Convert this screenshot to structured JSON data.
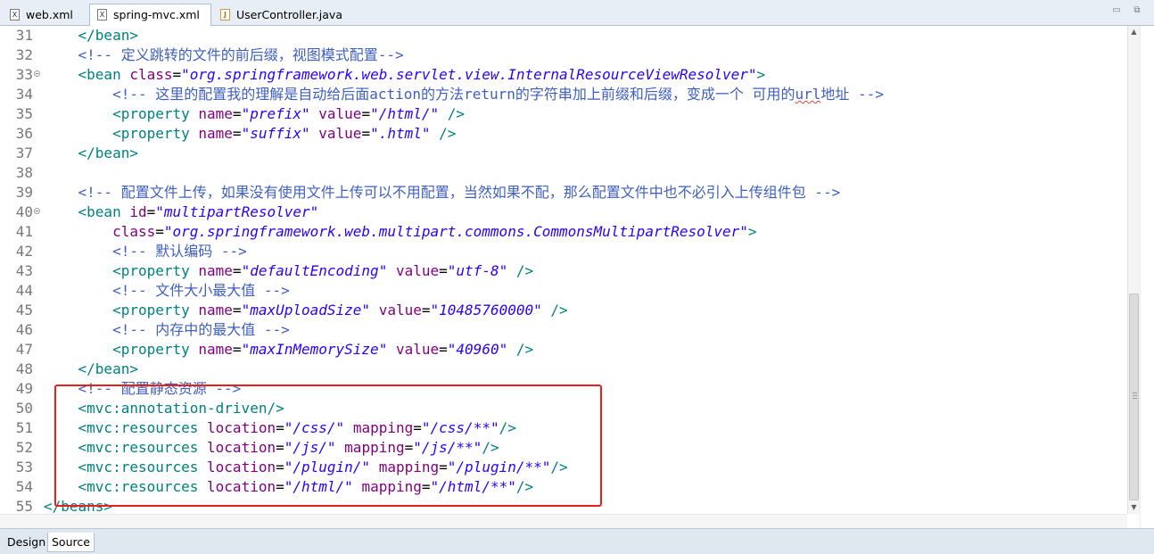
{
  "tabs": [
    {
      "label": "web.xml",
      "icon": "xml-file-icon",
      "active": false
    },
    {
      "label": "spring-mvc.xml",
      "icon": "xml-file-icon",
      "active": true
    },
    {
      "label": "UserController.java",
      "icon": "java-file-icon",
      "active": false
    }
  ],
  "editor_lines": [
    {
      "num": "31",
      "fold": false,
      "tokens": [
        [
          "    ",
          "p"
        ],
        [
          "</bean>",
          "t"
        ]
      ]
    },
    {
      "num": "32",
      "fold": false,
      "tokens": [
        [
          "    ",
          "p"
        ],
        [
          "<!-- ",
          "cm"
        ],
        [
          "定义跳转的文件的前后缀，视图模式配置",
          "cmc"
        ],
        [
          "-->",
          "cm"
        ]
      ]
    },
    {
      "num": "33",
      "fold": true,
      "tokens": [
        [
          "    ",
          "p"
        ],
        [
          "<bean ",
          "t"
        ],
        [
          "class",
          "an"
        ],
        [
          "=",
          "p"
        ],
        [
          "\"org.springframework.web.servlet.view.InternalResourceViewResolver\"",
          "av"
        ],
        [
          ">",
          "t"
        ]
      ]
    },
    {
      "num": "34",
      "fold": false,
      "tokens": [
        [
          "        ",
          "p"
        ],
        [
          "<!-- ",
          "cm"
        ],
        [
          "这里的配置我的理解是自动给后面",
          "cmc"
        ],
        [
          "action",
          "cm"
        ],
        [
          "的方法",
          "cmc"
        ],
        [
          "return",
          "cm"
        ],
        [
          "的字符串加上前缀和后缀，变成一个 可用的",
          "cmc"
        ],
        [
          "url",
          "cmsq"
        ],
        [
          "地址 ",
          "cmc"
        ],
        [
          "-->",
          "cm"
        ]
      ]
    },
    {
      "num": "35",
      "fold": false,
      "tokens": [
        [
          "        ",
          "p"
        ],
        [
          "<property ",
          "t"
        ],
        [
          "name",
          "an"
        ],
        [
          "=",
          "p"
        ],
        [
          "\"prefix\"",
          "av"
        ],
        [
          " ",
          "p"
        ],
        [
          "value",
          "an"
        ],
        [
          "=",
          "p"
        ],
        [
          "\"/html/\"",
          "av"
        ],
        [
          " />",
          "t"
        ]
      ]
    },
    {
      "num": "36",
      "fold": false,
      "tokens": [
        [
          "        ",
          "p"
        ],
        [
          "<property ",
          "t"
        ],
        [
          "name",
          "an"
        ],
        [
          "=",
          "p"
        ],
        [
          "\"suffix\"",
          "av"
        ],
        [
          " ",
          "p"
        ],
        [
          "value",
          "an"
        ],
        [
          "=",
          "p"
        ],
        [
          "\".html\"",
          "av"
        ],
        [
          " />",
          "t"
        ]
      ]
    },
    {
      "num": "37",
      "fold": false,
      "tokens": [
        [
          "    ",
          "p"
        ],
        [
          "</bean>",
          "t"
        ]
      ]
    },
    {
      "num": "38",
      "fold": false,
      "tokens": []
    },
    {
      "num": "39",
      "fold": false,
      "tokens": [
        [
          "    ",
          "p"
        ],
        [
          "<!-- ",
          "cm"
        ],
        [
          "配置文件上传，如果没有使用文件上传可以不用配置，当然如果不配，那么配置文件中也不必引入上传组件包 ",
          "cmc"
        ],
        [
          "-->",
          "cm"
        ]
      ]
    },
    {
      "num": "40",
      "fold": true,
      "tokens": [
        [
          "    ",
          "p"
        ],
        [
          "<bean ",
          "t"
        ],
        [
          "id",
          "an"
        ],
        [
          "=",
          "p"
        ],
        [
          "\"multipartResolver\"",
          "av"
        ]
      ]
    },
    {
      "num": "41",
      "fold": false,
      "tokens": [
        [
          "        ",
          "p"
        ],
        [
          "class",
          "an"
        ],
        [
          "=",
          "p"
        ],
        [
          "\"org.springframework.web.multipart.commons.CommonsMultipartResolver\"",
          "av"
        ],
        [
          ">",
          "t"
        ]
      ]
    },
    {
      "num": "42",
      "fold": false,
      "tokens": [
        [
          "        ",
          "p"
        ],
        [
          "<!-- ",
          "cm"
        ],
        [
          "默认编码 ",
          "cmc"
        ],
        [
          "-->",
          "cm"
        ]
      ]
    },
    {
      "num": "43",
      "fold": false,
      "tokens": [
        [
          "        ",
          "p"
        ],
        [
          "<property ",
          "t"
        ],
        [
          "name",
          "an"
        ],
        [
          "=",
          "p"
        ],
        [
          "\"defaultEncoding\"",
          "av"
        ],
        [
          " ",
          "p"
        ],
        [
          "value",
          "an"
        ],
        [
          "=",
          "p"
        ],
        [
          "\"utf-8\"",
          "av"
        ],
        [
          " />",
          "t"
        ]
      ]
    },
    {
      "num": "44",
      "fold": false,
      "tokens": [
        [
          "        ",
          "p"
        ],
        [
          "<!-- ",
          "cm"
        ],
        [
          "文件大小最大值 ",
          "cmc"
        ],
        [
          "-->",
          "cm"
        ]
      ]
    },
    {
      "num": "45",
      "fold": false,
      "tokens": [
        [
          "        ",
          "p"
        ],
        [
          "<property ",
          "t"
        ],
        [
          "name",
          "an"
        ],
        [
          "=",
          "p"
        ],
        [
          "\"maxUploadSize\"",
          "av"
        ],
        [
          " ",
          "p"
        ],
        [
          "value",
          "an"
        ],
        [
          "=",
          "p"
        ],
        [
          "\"10485760000\"",
          "av"
        ],
        [
          " />",
          "t"
        ]
      ]
    },
    {
      "num": "46",
      "fold": false,
      "tokens": [
        [
          "        ",
          "p"
        ],
        [
          "<!-- ",
          "cm"
        ],
        [
          "内存中的最大值 ",
          "cmc"
        ],
        [
          "-->",
          "cm"
        ]
      ]
    },
    {
      "num": "47",
      "fold": false,
      "tokens": [
        [
          "        ",
          "p"
        ],
        [
          "<property ",
          "t"
        ],
        [
          "name",
          "an"
        ],
        [
          "=",
          "p"
        ],
        [
          "\"maxInMemorySize\"",
          "av"
        ],
        [
          " ",
          "p"
        ],
        [
          "value",
          "an"
        ],
        [
          "=",
          "p"
        ],
        [
          "\"40960\"",
          "av"
        ],
        [
          " />",
          "t"
        ]
      ]
    },
    {
      "num": "48",
      "fold": false,
      "tokens": [
        [
          "    ",
          "p"
        ],
        [
          "</bean>",
          "t"
        ]
      ]
    },
    {
      "num": "49",
      "fold": false,
      "tokens": [
        [
          "    ",
          "p"
        ],
        [
          "<!-- ",
          "cm"
        ],
        [
          "配置静态资源 ",
          "cmc"
        ],
        [
          "-->",
          "cm"
        ]
      ]
    },
    {
      "num": "50",
      "fold": false,
      "tokens": [
        [
          "    ",
          "p"
        ],
        [
          "<mvc:annotation-driven/>",
          "t"
        ]
      ]
    },
    {
      "num": "51",
      "fold": false,
      "tokens": [
        [
          "    ",
          "p"
        ],
        [
          "<mvc:resources ",
          "t"
        ],
        [
          "location",
          "an"
        ],
        [
          "=",
          "p"
        ],
        [
          "\"/css/\"",
          "av"
        ],
        [
          " ",
          "p"
        ],
        [
          "mapping",
          "an"
        ],
        [
          "=",
          "p"
        ],
        [
          "\"/css/**\"",
          "av"
        ],
        [
          "/>",
          "t"
        ]
      ]
    },
    {
      "num": "52",
      "fold": false,
      "tokens": [
        [
          "    ",
          "p"
        ],
        [
          "<mvc:resources ",
          "t"
        ],
        [
          "location",
          "an"
        ],
        [
          "=",
          "p"
        ],
        [
          "\"/js/\"",
          "av"
        ],
        [
          " ",
          "p"
        ],
        [
          "mapping",
          "an"
        ],
        [
          "=",
          "p"
        ],
        [
          "\"/js/**\"",
          "av"
        ],
        [
          "/>",
          "t"
        ]
      ]
    },
    {
      "num": "53",
      "fold": false,
      "tokens": [
        [
          "    ",
          "p"
        ],
        [
          "<mvc:resources ",
          "t"
        ],
        [
          "location",
          "an"
        ],
        [
          "=",
          "p"
        ],
        [
          "\"/plugin/\"",
          "av"
        ],
        [
          " ",
          "p"
        ],
        [
          "mapping",
          "an"
        ],
        [
          "=",
          "p"
        ],
        [
          "\"/plugin/**\"",
          "av"
        ],
        [
          "/>",
          "t"
        ]
      ]
    },
    {
      "num": "54",
      "fold": false,
      "tokens": [
        [
          "    ",
          "p"
        ],
        [
          "<mvc:resources ",
          "t"
        ],
        [
          "location",
          "an"
        ],
        [
          "=",
          "p"
        ],
        [
          "\"/html/\"",
          "av"
        ],
        [
          " ",
          "p"
        ],
        [
          "mapping",
          "an"
        ],
        [
          "=",
          "p"
        ],
        [
          "\"/html/**\"",
          "av"
        ],
        [
          "/>",
          "t"
        ]
      ]
    },
    {
      "num": "55",
      "fold": false,
      "tokens": [
        [
          "</beans>",
          "t"
        ]
      ]
    }
  ],
  "bottom_tabs": [
    {
      "label": "Design",
      "active": false
    },
    {
      "label": "Source",
      "active": true
    }
  ],
  "window_controls": {
    "minimize": "▭",
    "maximize": "⧉"
  },
  "colors": {
    "tag": "#008080",
    "attr_name": "#7f007f",
    "attr_value": "#2a00ff",
    "comment": "#3f5fbf",
    "highlight_box": "#e8201c"
  }
}
